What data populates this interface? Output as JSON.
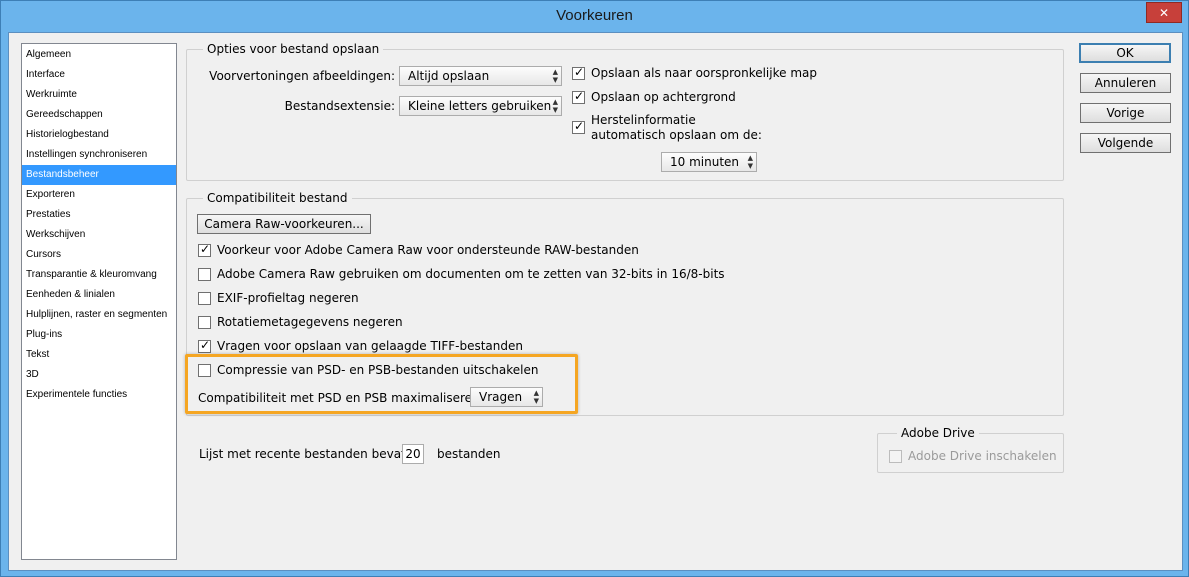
{
  "window": {
    "title": "Voorkeuren",
    "close_glyph": "✕"
  },
  "sidebar": {
    "items": [
      {
        "label": "Algemeen"
      },
      {
        "label": "Interface"
      },
      {
        "label": "Werkruimte"
      },
      {
        "label": "Gereedschappen"
      },
      {
        "label": "Historielogbestand"
      },
      {
        "label": "Instellingen synchroniseren"
      },
      {
        "label": "Bestandsbeheer"
      },
      {
        "label": "Exporteren"
      },
      {
        "label": "Prestaties"
      },
      {
        "label": "Werkschijven"
      },
      {
        "label": "Cursors"
      },
      {
        "label": "Transparantie & kleuromvang"
      },
      {
        "label": "Eenheden & linialen"
      },
      {
        "label": "Hulplijnen, raster en segmenten"
      },
      {
        "label": "Plug-ins"
      },
      {
        "label": "Tekst"
      },
      {
        "label": "3D"
      },
      {
        "label": "Experimentele functies"
      }
    ],
    "selected": "Bestandsbeheer"
  },
  "save_options": {
    "title": "Opties voor bestand opslaan",
    "preview_label": "Voorvertoningen afbeeldingen:",
    "preview_value": "Altijd opslaan",
    "extension_label": "Bestandsextensie:",
    "extension_value": "Kleine letters gebruiken",
    "save_original_folder": "Opslaan als naar oorspronkelijke map",
    "save_background": "Opslaan op achtergrond",
    "recovery_line1": "Herstelinformatie",
    "recovery_line2": "automatisch opslaan om de:",
    "recovery_interval": "10 minuten"
  },
  "compat": {
    "title": "Compatibiliteit bestand",
    "camera_raw_button": "Camera Raw-voorkeuren...",
    "pref_acr": "Voorkeur voor Adobe Camera Raw voor ondersteunde RAW-bestanden",
    "acr_32bit": "Adobe Camera Raw gebruiken om documenten om te zetten van 32-bits in 16/8-bits",
    "ignore_exif": "EXIF-profieltag negeren",
    "ignore_rotation": "Rotatiemetagegevens negeren",
    "ask_tiff": "Vragen voor opslaan van gelaagde TIFF-bestanden",
    "disable_compression": "Compressie van PSD- en PSB-bestanden uitschakelen",
    "maximize_label": "Compatibiliteit met PSD en PSB maximaliseren:",
    "maximize_value": "Vragen"
  },
  "recent": {
    "label": "Lijst met recente bestanden bevat:",
    "value": "20",
    "suffix": "bestanden"
  },
  "drive": {
    "title": "Adobe Drive",
    "enable": "Adobe Drive inschakelen"
  },
  "buttons": {
    "ok": "OK",
    "cancel": "Annuleren",
    "previous": "Vorige",
    "next": "Volgende"
  },
  "colors": {
    "title_bar": "#6bb4ec",
    "selection": "#3399ff",
    "highlight": "#f5a623"
  }
}
